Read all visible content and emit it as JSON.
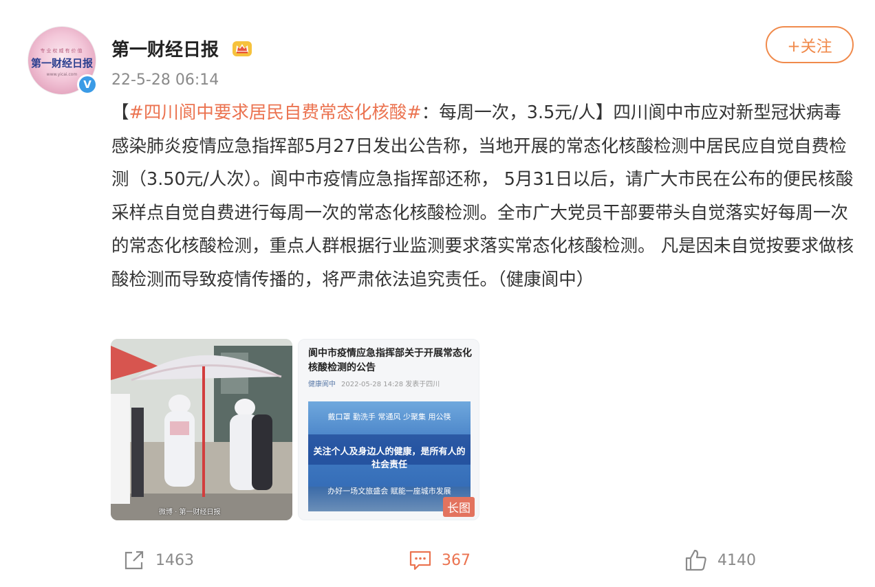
{
  "author": {
    "name": "第一财经日报",
    "avatar_top_text": "专业权威有价值",
    "avatar_logo_text": "第一财经日报",
    "avatar_url_text": "www.yicai.com",
    "verified_mark": "V",
    "badge_icon": "crown-icon"
  },
  "post": {
    "time": "22-5-28 06:14",
    "text_prefix": "【",
    "hashtag": "#四川阆中要求居民自费常态化核酸#",
    "text_body": "：每周一次，3.5元/人】四川阆中市应对新型冠状病毒感染肺炎疫情应急指挥部5月27日发出公告称，当地开展的常态化核酸检测中居民应自觉自费检测（3.50元/人次）。阆中市疫情应急指挥部还称， 5月31日以后，请广大市民在公布的便民核酸采样点自觉自费进行每周一次的常态化核酸检测。全市广大党员干部要带头自觉落实好每周一次的常态化核酸检测，重点人群根据行业监测要求落实常态化核酸检测。 凡是因未自觉按要求做核酸检测而导致疫情传播的，将严肃依法追究责任。（健康阆中）"
  },
  "follow_button": {
    "label": "+关注"
  },
  "images": {
    "left": {
      "watermark": "微博 · 第一财经日报"
    },
    "right": {
      "title": "阆中市疫情应急指挥部关于开展常态化核酸检测的公告",
      "source": "健康阆中",
      "meta": "2022-05-28 14:28  发表于四川",
      "banner_line1": "戴口罩 勤洗手 常通风 少聚集 用公筷",
      "banner_line2": "关注个人及身边人的健康，是所有人的社会责任",
      "banner_line3": "办好一场文旅盛会  赋能一座城市发展",
      "badge": "长图"
    }
  },
  "actions": {
    "repost": {
      "icon": "share-icon",
      "count": "1463"
    },
    "comment": {
      "icon": "comment-icon",
      "count": "367"
    },
    "like": {
      "icon": "thumbs-up-icon",
      "count": "4140"
    }
  },
  "colors": {
    "accent": "#eb7350",
    "follow": "#f08a4b",
    "verified": "#3b9be6",
    "muted": "#8a8a8a"
  }
}
